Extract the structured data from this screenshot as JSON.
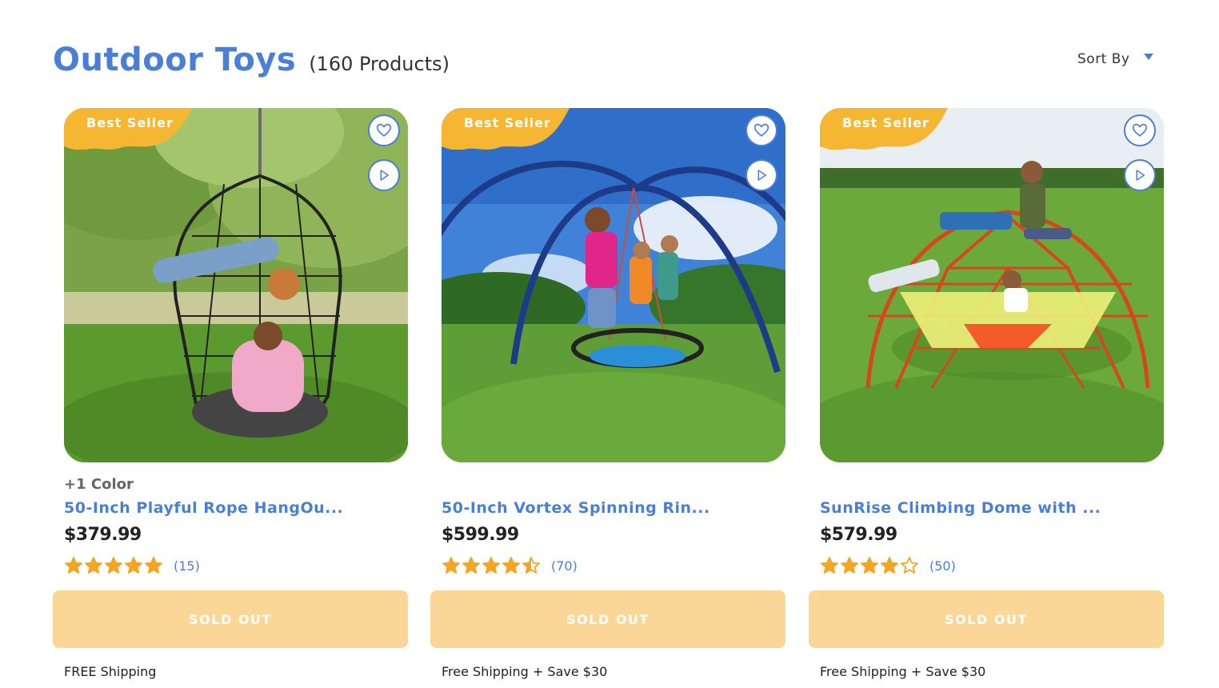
{
  "header": {
    "title": "Outdoor Toys",
    "count": "(160 Products)"
  },
  "sort": {
    "label": "Sort By"
  },
  "colors": {
    "accent": "#4a7fd6",
    "badge": "#f5b731",
    "sold_out": "#fad797",
    "star": "#f4a623"
  },
  "products": [
    {
      "badge": "Best Seller",
      "color_count": "+1 Color",
      "name": "50-Inch Playful Rope HangOu...",
      "price": "$379.99",
      "rating": 5,
      "reviews": "(15)",
      "button": "SOLD OUT",
      "shipping": "FREE Shipping"
    },
    {
      "badge": "Best Seller",
      "color_count": "",
      "name": "50-Inch Vortex Spinning Rin...",
      "price": "$599.99",
      "rating": 4.5,
      "reviews": "(70)",
      "button": "SOLD OUT",
      "shipping": "Free Shipping + Save $30"
    },
    {
      "badge": "Best Seller",
      "color_count": "",
      "name": "SunRise Climbing Dome with ...",
      "price": "$579.99",
      "rating": 4,
      "reviews": "(50)",
      "button": "SOLD OUT",
      "shipping": "Free Shipping + Save $30"
    }
  ],
  "icons": {
    "wishlist": "heart-icon",
    "video": "play-icon",
    "rating": "star-icon",
    "sort": "chevron-down-icon"
  }
}
